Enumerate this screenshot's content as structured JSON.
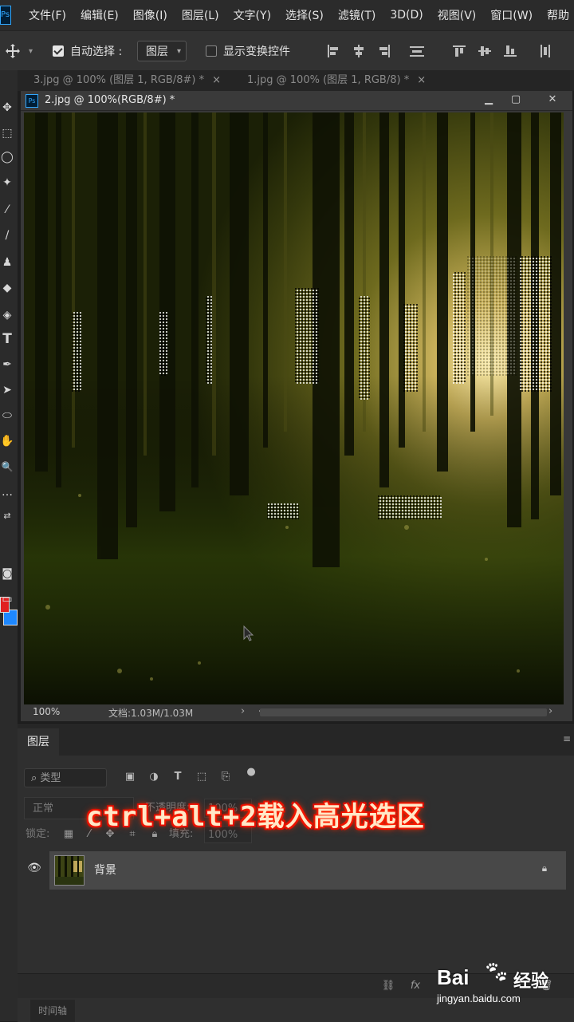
{
  "app": {
    "logo_text": "Ps",
    "menu": [
      "文件(F)",
      "编辑(E)",
      "图像(I)",
      "图层(L)",
      "文字(Y)",
      "选择(S)",
      "滤镜(T)",
      "3D(D)",
      "视图(V)",
      "窗口(W)",
      "帮助"
    ]
  },
  "options_bar": {
    "move_tool_icon": "move-icon",
    "auto_select_label": "自动选择 :",
    "auto_select_checked": true,
    "auto_select_target": "图层",
    "show_transform_label": "显示变换控件",
    "show_transform_checked": false
  },
  "tabs": [
    {
      "label": "3.jpg @ 100% (图层 1, RGB/8#) *",
      "close": "×"
    },
    {
      "label": "1.jpg @ 100% (图层 1, RGB/8) *",
      "close": "×"
    }
  ],
  "document": {
    "icon_text": "Ps",
    "title": "2.jpg @ 100%(RGB/8#) *",
    "minimize": "▁",
    "maximize": "▢",
    "close": "✕",
    "zoom": "100%",
    "doc_size": "文档:1.03M/1.03M",
    "scroll_left": "‹",
    "scroll_right": "›",
    "nav_right": "›"
  },
  "toolbar": {
    "tools": [
      "move-icon",
      "marquee-icon",
      "lasso-icon",
      "magic-wand-icon",
      "eyedropper-icon",
      "brush-icon",
      "stamp-icon",
      "eraser-icon",
      "paint-bucket-icon",
      "type-icon",
      "pen-icon",
      "path-select-icon",
      "ellipse-icon",
      "hand-icon",
      "zoom-icon",
      "more-icon",
      "swap-icon"
    ],
    "glyphs": [
      "✥",
      "⬚",
      "◯",
      "✦",
      "⁄",
      "/",
      "♟",
      "◆",
      "◈",
      "T",
      "✒",
      "➤",
      "⬭",
      "✋",
      "🔍",
      "…",
      "⇄"
    ],
    "foreground_color": "#e02020",
    "background_color": "#1e88ff",
    "quick_mask_glyph": "◙",
    "screen_mode_glyph": "▭"
  },
  "layers_panel": {
    "tab_label": "图层",
    "menu_glyph": "≡",
    "filter_label": "类型",
    "blend_mode": "正常",
    "opacity_label": "不透明度:",
    "opacity_value": "100%",
    "lock_label": "锁定:",
    "fill_label": "填充:",
    "fill_value": "100%",
    "layers": [
      {
        "name": "背景",
        "visible": true,
        "locked": true
      }
    ],
    "footer_glyphs": [
      "⛓",
      "fx"
    ],
    "timeline_label": "时间轴"
  },
  "caption": "ctrl+alt+2载入高光选区",
  "watermark": {
    "logo": "Bai",
    "logo_suffix": "du",
    "paw": "🐾",
    "jingyan": "经验",
    "url": "jingyan.baidu.com"
  }
}
